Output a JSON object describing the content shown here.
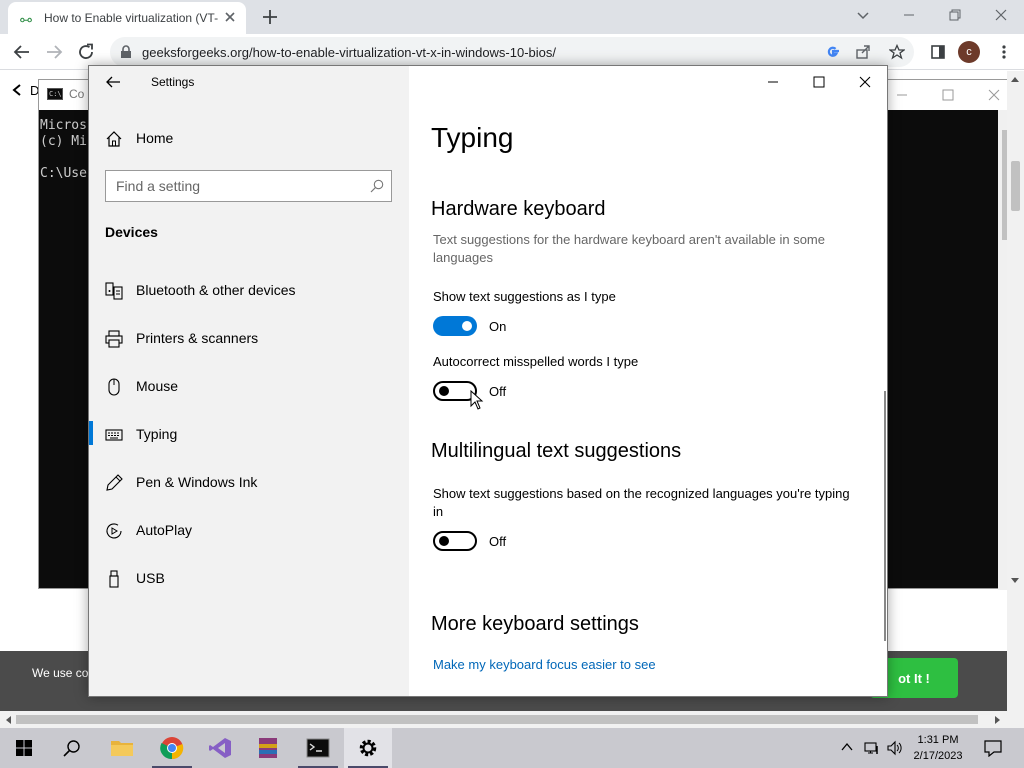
{
  "browser": {
    "tab_title": "How to Enable virtualization (VT-",
    "tab_favicon": "GfG",
    "url": "geeksforgeeks.org/how-to-enable-virtualization-vt-x-in-windows-10-bios/",
    "profile_initial": "c"
  },
  "page": {
    "cmd_title": "Co",
    "cmd_lines": "Micros\n(c) Mi\n\nC:\\Use",
    "cmd_left_char": "D",
    "cookie_text": "We use co",
    "cookie_button": "ot It !"
  },
  "settings": {
    "window_title": "Settings",
    "home_label": "Home",
    "search_placeholder": "Find a setting",
    "section": "Devices",
    "nav": [
      {
        "label": "Bluetooth & other devices",
        "icon": "bluetooth-devices-icon"
      },
      {
        "label": "Printers & scanners",
        "icon": "printer-icon"
      },
      {
        "label": "Mouse",
        "icon": "mouse-icon"
      },
      {
        "label": "Typing",
        "icon": "keyboard-icon",
        "active": true
      },
      {
        "label": "Pen & Windows Ink",
        "icon": "pen-icon"
      },
      {
        "label": "AutoPlay",
        "icon": "autoplay-icon"
      },
      {
        "label": "USB",
        "icon": "usb-icon"
      }
    ],
    "page_title": "Typing",
    "hardware": {
      "heading": "Hardware keyboard",
      "description": "Text suggestions for the hardware keyboard aren't available in some languages",
      "show_suggestions_label": "Show text suggestions as I type",
      "show_suggestions_state": "On",
      "autocorrect_label": "Autocorrect misspelled words I type",
      "autocorrect_state": "Off"
    },
    "multilingual": {
      "heading": "Multilingual text suggestions",
      "label": "Show text suggestions based on the recognized languages you're typing in",
      "state": "Off"
    },
    "more": {
      "heading": "More keyboard settings",
      "link": "Make my keyboard focus easier to see"
    }
  },
  "taskbar": {
    "time": "1:31 PM",
    "date": "2/17/2023"
  },
  "colors": {
    "accent": "#0078d7",
    "link": "#0067b8",
    "cookie_button": "#2ebf41"
  }
}
